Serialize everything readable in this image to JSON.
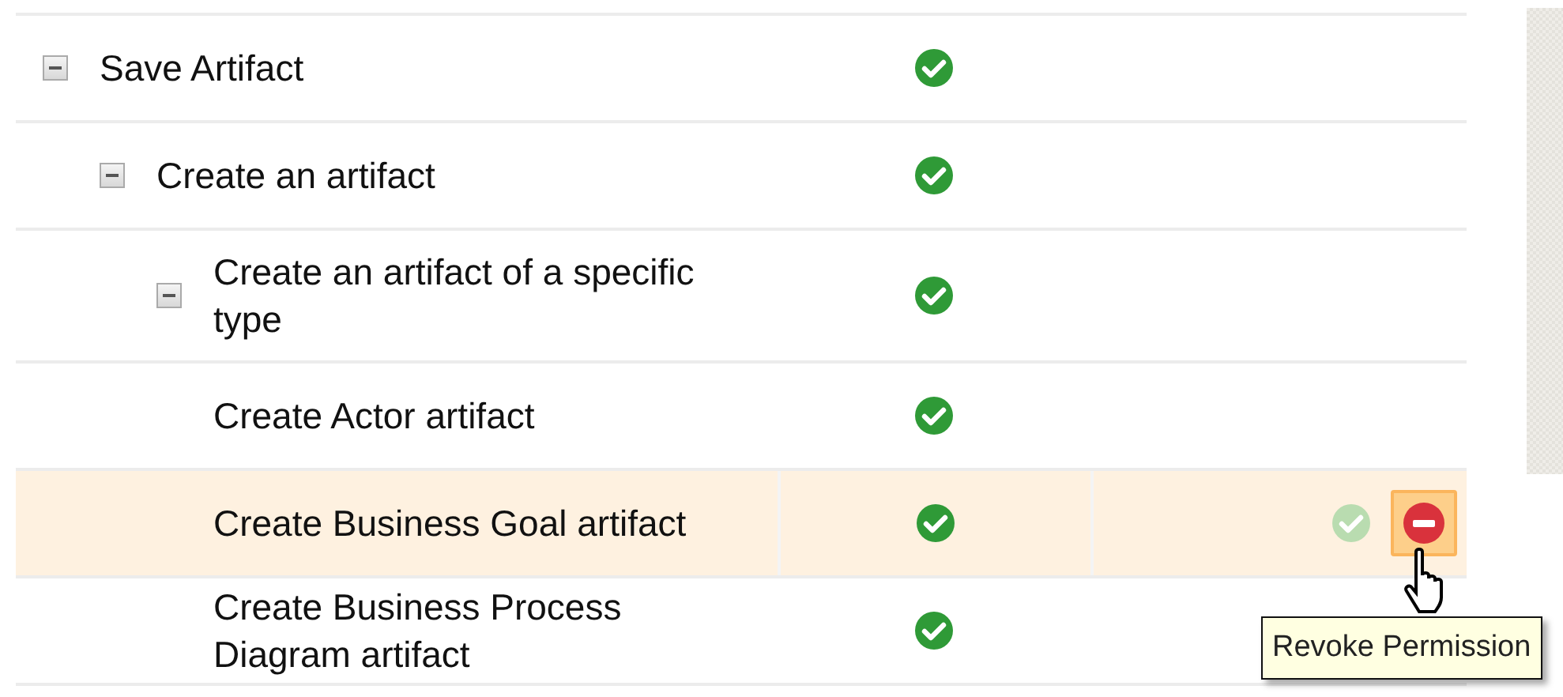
{
  "permissions": {
    "rows": [
      {
        "label": "Save Artifact",
        "expanded": true,
        "granted": true,
        "highlighted": false,
        "children": [
          {
            "label": "Create an artifact",
            "expanded": true,
            "granted": true,
            "highlighted": false,
            "children": [
              {
                "label": "Create an artifact of a specific type",
                "expanded": true,
                "granted": true,
                "highlighted": false,
                "children": [
                  {
                    "label": "Create Actor artifact",
                    "granted": true,
                    "highlighted": false
                  },
                  {
                    "label": "Create Business Goal artifact",
                    "granted": true,
                    "highlighted": true,
                    "actions": [
                      {
                        "kind": "grant",
                        "hovered": false
                      },
                      {
                        "kind": "revoke",
                        "hovered": true
                      }
                    ]
                  },
                  {
                    "label": "Create Business Process Diagram artifact",
                    "granted": true,
                    "highlighted": false
                  }
                ]
              }
            ]
          }
        ]
      }
    ]
  },
  "tooltip": {
    "text": "Revoke Permission"
  }
}
